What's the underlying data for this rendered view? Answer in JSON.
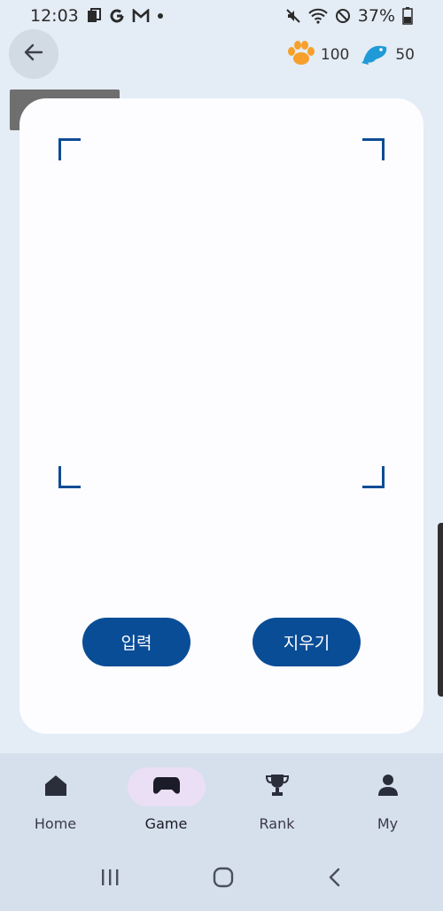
{
  "status_bar": {
    "time": "12:03",
    "left_icons": [
      "calendar-icon",
      "google-icon",
      "gmail-icon",
      "dot-icon"
    ],
    "battery": "37%",
    "right_icons": [
      "mute-icon",
      "wifi-icon",
      "do-not-disturb-icon",
      "battery-icon"
    ]
  },
  "header": {
    "back_tooltip": "위로 이동",
    "paw_count": "100",
    "fish_count": "50",
    "paw_color": "#f6a02b",
    "fish_color": "#1f9ad6"
  },
  "card": {
    "input_label": "입력",
    "clear_label": "지우기",
    "accent_color": "#0a4d97"
  },
  "bottom_nav": {
    "items": [
      {
        "label": "Home",
        "icon": "home-icon",
        "active": false
      },
      {
        "label": "Game",
        "icon": "gamepad-icon",
        "active": true
      },
      {
        "label": "Rank",
        "icon": "trophy-icon",
        "active": false
      },
      {
        "label": "My",
        "icon": "person-icon",
        "active": false
      }
    ]
  },
  "system_nav": {
    "icons": [
      "recents-icon",
      "home-circle-icon",
      "back-chevron-icon"
    ]
  }
}
